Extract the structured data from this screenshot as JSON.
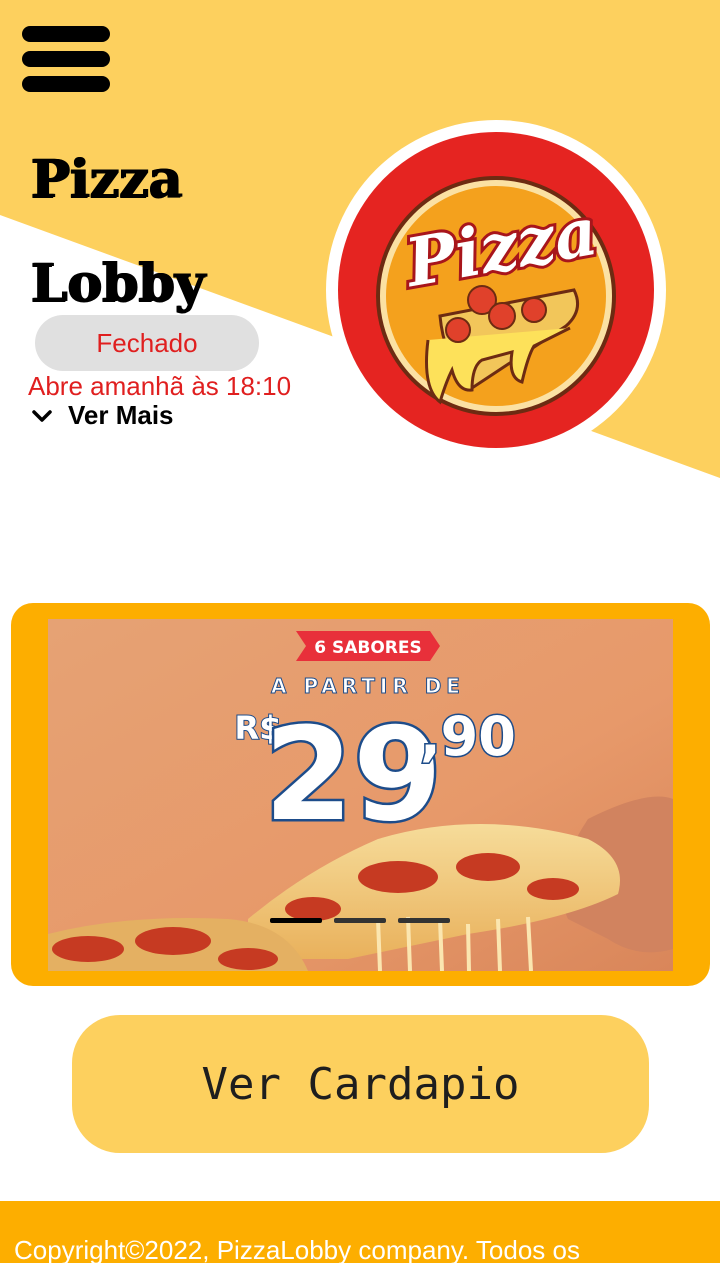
{
  "header": {
    "title_line1": "Pizza",
    "title_line2": "Lobby",
    "status": "Fechado",
    "opens_text": "Abre amanhã às 18:10",
    "ver_mais_label": "Ver Mais"
  },
  "logo": {
    "text": "Pizza"
  },
  "banner": {
    "badge": "6 SABORES",
    "from_label": "A PARTIR DE",
    "currency": "R$",
    "price_main": "29",
    "price_cents": ",90",
    "slide_count": 3,
    "active_slide": 1
  },
  "menu_button": {
    "label": "Ver Cardapio"
  },
  "footer": {
    "copyright": "Copyright©2022, PizzaLobby company. Todos os"
  },
  "colors": {
    "yellow": "#fdd05e",
    "orange": "#fdae00",
    "red": "#e01f1f",
    "logo_red": "#e52421"
  }
}
